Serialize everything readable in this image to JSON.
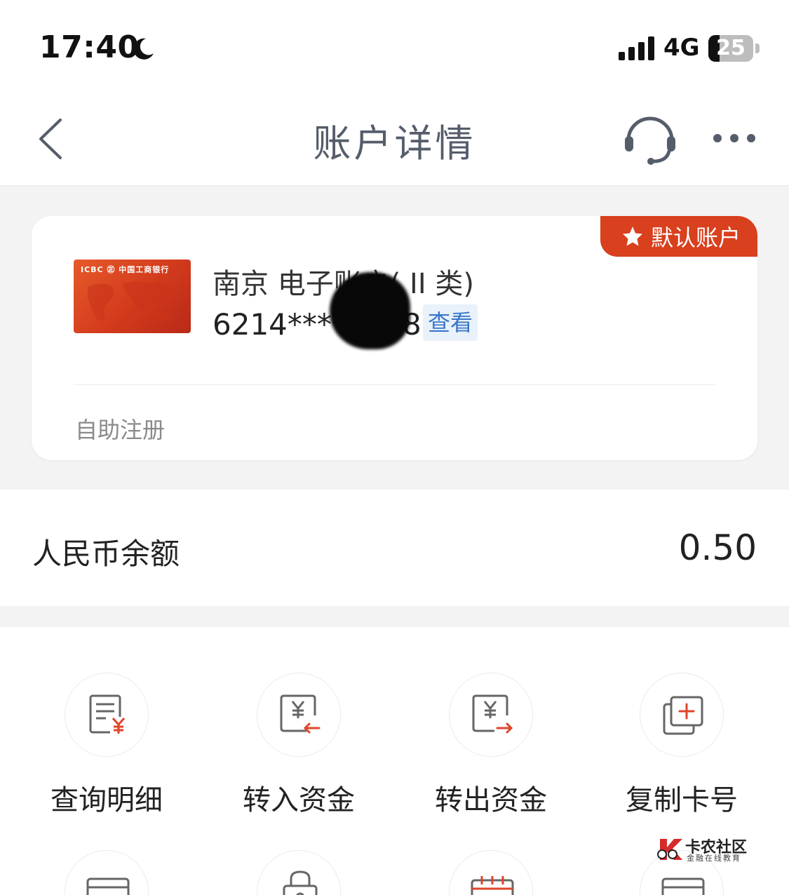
{
  "status_bar": {
    "time": "17:40",
    "network": "4G",
    "battery": "25",
    "battery_level": 0.25
  },
  "nav": {
    "title": "账户详情"
  },
  "account_card": {
    "badge": "默认账户",
    "name": "南京  电子账户( II 类)",
    "number": "6214****5448",
    "view_label": "查看",
    "tag": "自助注册",
    "card_logo": "ICBC ㊣ 中国工商银行"
  },
  "balance": {
    "label": "人民币余额",
    "value": "0.50"
  },
  "actions": [
    {
      "label": "查询明细",
      "icon": "statement-icon"
    },
    {
      "label": "转入资金",
      "icon": "transfer-in-icon"
    },
    {
      "label": "转出资金",
      "icon": "transfer-out-icon"
    },
    {
      "label": "复制卡号",
      "icon": "copy-card-icon"
    }
  ],
  "watermark": {
    "title": "卡农社区",
    "subtitle": "金融在线教育"
  },
  "colors": {
    "accent_red": "#d8401e",
    "link_blue": "#3876c8",
    "nav_gray": "#555d6b"
  }
}
